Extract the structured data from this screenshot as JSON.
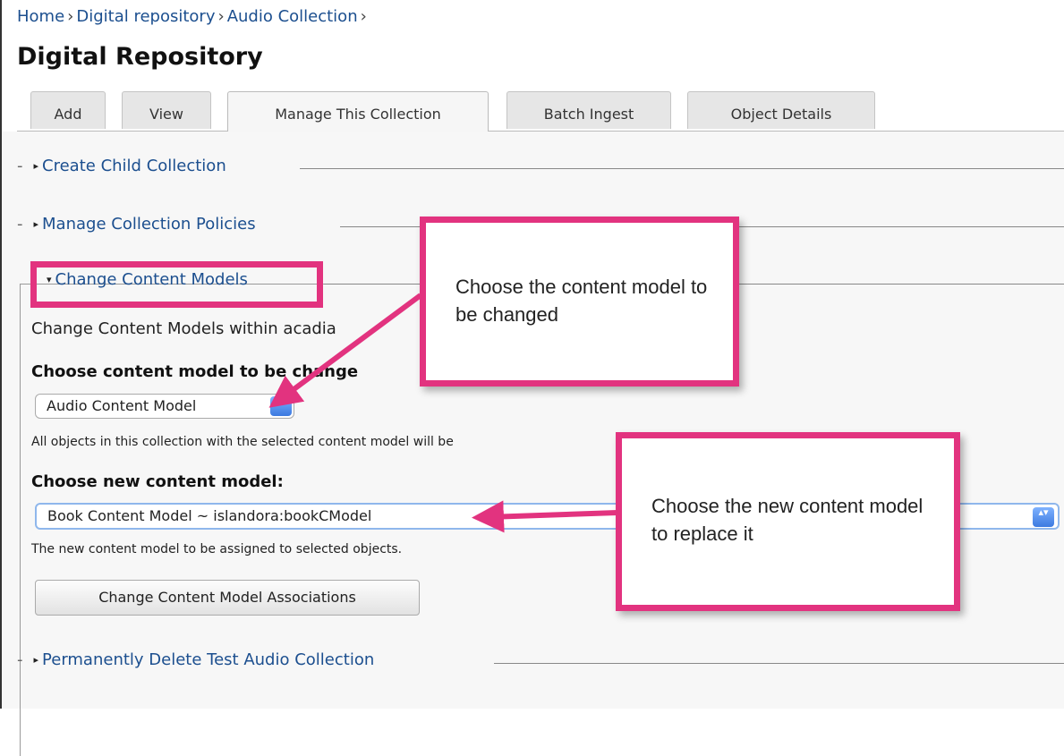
{
  "breadcrumb": {
    "items": [
      "Home",
      "Digital repository",
      "Audio Collection"
    ],
    "separator": "›"
  },
  "page": {
    "title": "Digital Repository"
  },
  "tabs": [
    {
      "label": "Add",
      "active": false
    },
    {
      "label": "View",
      "active": false
    },
    {
      "label": "Manage This Collection",
      "active": true
    },
    {
      "label": "Batch Ingest",
      "active": false
    },
    {
      "label": "Object Details",
      "active": false
    }
  ],
  "sections": {
    "create_child": {
      "dash": "-",
      "label": "Create Child Collection"
    },
    "manage_policies": {
      "dash": "-",
      "label": "Manage Collection Policies"
    },
    "change_models": {
      "label": "Change Content Models",
      "intro": "Change Content Models within acadia",
      "choose_old_label": "Choose content model to be change",
      "old_select_value": "Audio Content Model",
      "old_help": "All objects in this collection with the selected content model will be",
      "choose_new_label": "Choose new content model:",
      "new_select_value": "Book Content Model ~ islandora:bookCModel",
      "new_help": "The new content model to be assigned to selected objects.",
      "submit_label": "Change Content Model Associations"
    },
    "delete": {
      "dash": "-",
      "label": "Permanently Delete Test Audio Collection"
    }
  },
  "callouts": {
    "first": "Choose the content model to be changed",
    "second": "Choose the new content model to replace it"
  },
  "colors": {
    "callout_border": "#e2337f",
    "link": "#1c4f8f"
  },
  "icons": {
    "collapsed_arrow": "▸",
    "expanded_arrow": "▾",
    "select_arrow": "▴▾"
  }
}
